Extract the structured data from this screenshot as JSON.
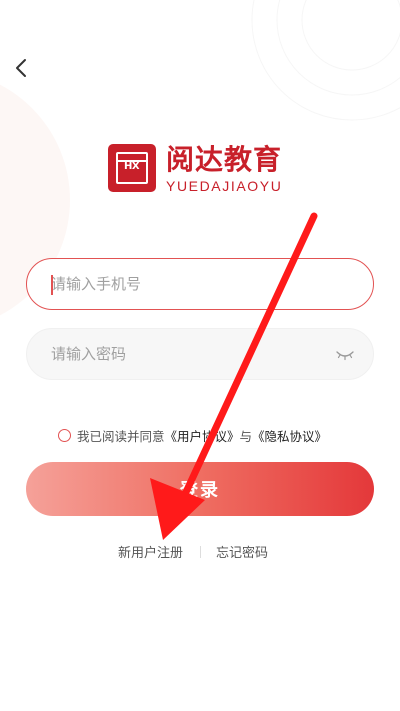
{
  "header": {
    "back_icon": "chevron-left-icon"
  },
  "logo": {
    "mark": "HX",
    "name_cn": "阅达教育",
    "name_en": "YUEDAJIAOYU",
    "brand_color": "#c8202a"
  },
  "form": {
    "phone": {
      "value": "",
      "placeholder": "请输入手机号"
    },
    "password": {
      "value": "",
      "placeholder": "请输入密码",
      "toggle_icon": "eye-closed-icon"
    }
  },
  "agreement": {
    "prefix": "我已阅读并同意",
    "user_agreement": "《用户协议》",
    "joiner": "与",
    "privacy_policy": "《隐私协议》",
    "checked": false
  },
  "login_button": {
    "label": "登录",
    "gradient": [
      "#f5a199",
      "#e4383a"
    ]
  },
  "footer_links": {
    "register": "新用户注册",
    "forgot": "忘记密码"
  },
  "annotation": {
    "type": "arrow",
    "color": "#ff1a1a"
  }
}
